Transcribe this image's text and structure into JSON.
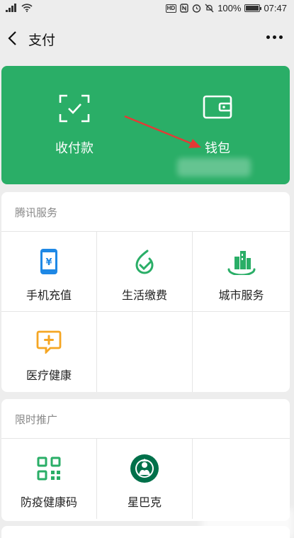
{
  "status_bar": {
    "time": "07:47",
    "battery": "100%",
    "battery_level": 1.0,
    "icons": [
      "signal-icon",
      "wifi-icon",
      "hd-icon",
      "nfc-icon",
      "alarm-icon",
      "mute-icon",
      "battery-icon"
    ]
  },
  "header": {
    "title": "支付",
    "back_icon": "chevron-left-icon",
    "more_icon": "more-dots-icon"
  },
  "hero": {
    "background": "#2aae67",
    "items": [
      {
        "label": "收付款",
        "icon": "scan-qr-icon"
      },
      {
        "label": "钱包",
        "icon": "wallet-icon"
      }
    ],
    "annotation": {
      "type": "red-arrow",
      "color": "#e53935"
    }
  },
  "tencent_services": {
    "title": "腾讯服务",
    "items": [
      {
        "label": "手机充值",
        "icon": "phone-recharge-icon",
        "color": "#1e88e5"
      },
      {
        "label": "生活缴费",
        "icon": "utility-bill-icon",
        "color": "#2aae67"
      },
      {
        "label": "城市服务",
        "icon": "city-service-icon",
        "color": "#2aae67"
      },
      {
        "label": "医疗健康",
        "icon": "medical-health-icon",
        "color": "#f5a623"
      }
    ]
  },
  "promotions": {
    "title": "限时推广",
    "items": [
      {
        "label": "防疫健康码",
        "icon": "health-qr-code-icon",
        "color": "#2aae67"
      },
      {
        "label": "星巴克",
        "icon": "starbucks-logo-icon",
        "color": "#00704a"
      }
    ]
  }
}
